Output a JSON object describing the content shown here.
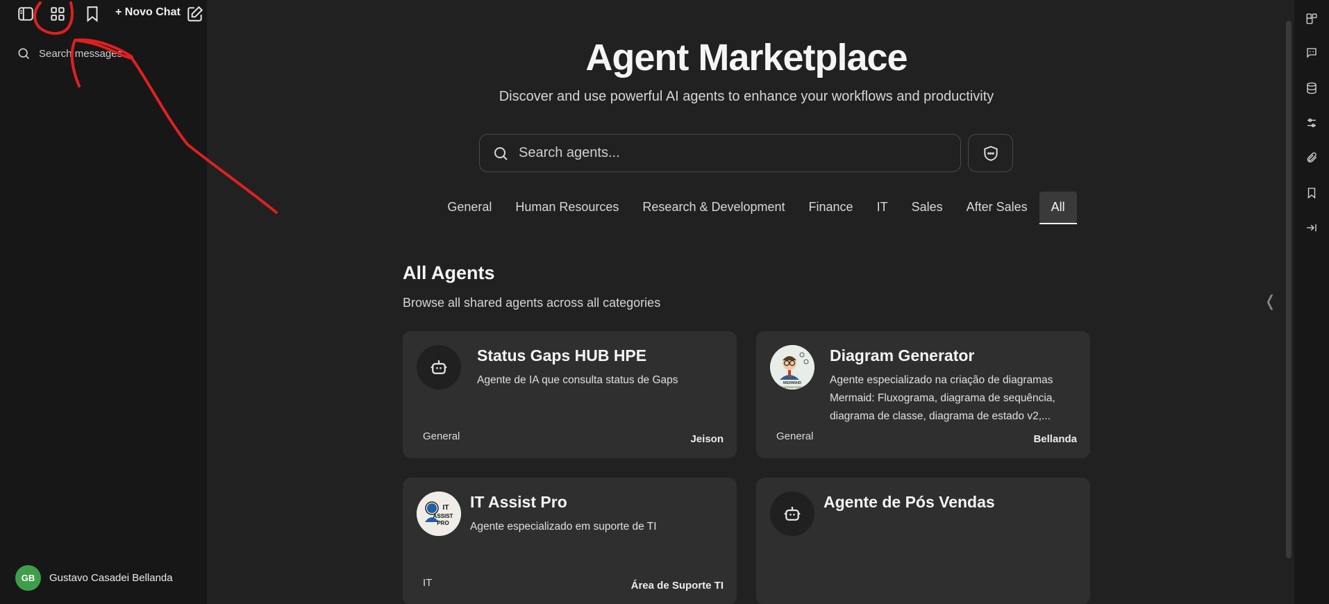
{
  "sidebar": {
    "new_chat_label": "+ Novo Chat",
    "search_placeholder": "Search messages",
    "user": {
      "initials": "GB",
      "name": "Gustavo Casadei Bellanda",
      "avatar_color": "#3f9e4a"
    },
    "icons": [
      "sidebar-toggle-icon",
      "grid-icon",
      "bookmark-icon",
      "edit-icon"
    ]
  },
  "main": {
    "title": "Agent Marketplace",
    "subtitle": "Discover and use powerful AI agents to enhance your workflows and productivity",
    "search_placeholder": "Search agents...",
    "tabs": [
      "General",
      "Human Resources",
      "Research & Development",
      "Finance",
      "IT",
      "Sales",
      "After Sales",
      "All"
    ],
    "active_tab": "All",
    "section_title": "All Agents",
    "section_subtitle": "Browse all shared agents across all categories",
    "agents": [
      {
        "name": "Status Gaps HUB HPE",
        "description": "Agente de IA que consulta status de Gaps",
        "category": "General",
        "author": "Jeison",
        "icon": "robot-icon"
      },
      {
        "name": "Diagram Generator",
        "description": "Agente especializado na criação de diagramas Mermaid: Fluxograma, diagrama de sequência, diagrama de classe, diagrama de estado v2,...",
        "category": "General",
        "author": "Bellanda",
        "icon": "mermaid-logo",
        "logo_text": "MERMAID DIAGRAM AGENT"
      },
      {
        "name": "IT Assist Pro",
        "description": "Agente especializado em suporte de TI",
        "category": "IT",
        "author": "Área de Suporte TI",
        "icon": "it-assist-logo",
        "logo_text": "IT ASSIST PRO"
      },
      {
        "name": "Agente de Pós Vendas",
        "description": "",
        "category": "",
        "author": "",
        "icon": "robot-icon"
      }
    ]
  },
  "colors": {
    "background": "#212121",
    "sidebar": "#171717",
    "card": "#2f2f2f",
    "annotation": "#e02020"
  }
}
